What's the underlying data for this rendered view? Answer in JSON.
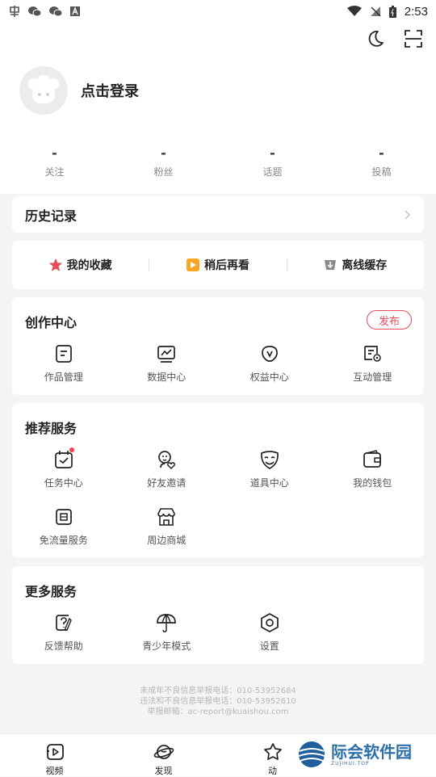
{
  "status_bar": {
    "time": "2:53",
    "left_icons": [
      "app-icon",
      "wechat-icon",
      "wechat-icon",
      "a-icon"
    ],
    "right_icons": [
      "wifi-icon",
      "no-signal-icon",
      "battery-icon"
    ]
  },
  "header": {
    "login_text": "点击登录"
  },
  "stats": [
    {
      "value": "-",
      "label": "关注"
    },
    {
      "value": "-",
      "label": "粉丝"
    },
    {
      "value": "-",
      "label": "话题"
    },
    {
      "value": "-",
      "label": "投稿"
    }
  ],
  "history": {
    "title": "历史记录"
  },
  "shortcuts": [
    {
      "label": "我的收藏",
      "icon": "star-icon",
      "color": "#e94b58"
    },
    {
      "label": "稍后再看",
      "icon": "play-icon",
      "color": "#f5a623"
    },
    {
      "label": "离线缓存",
      "icon": "download-icon",
      "color": "#8a8a8a"
    }
  ],
  "creator": {
    "title": "创作中心",
    "publish_label": "发布",
    "items": [
      {
        "label": "作品管理",
        "icon": "works-icon"
      },
      {
        "label": "数据中心",
        "icon": "chart-icon"
      },
      {
        "label": "权益中心",
        "icon": "rights-icon"
      },
      {
        "label": "互动管理",
        "icon": "interaction-icon"
      }
    ]
  },
  "recommended": {
    "title": "推荐服务",
    "items": [
      {
        "label": "任务中心",
        "icon": "calendar-icon",
        "badge": true
      },
      {
        "label": "好友邀请",
        "icon": "invite-icon"
      },
      {
        "label": "道具中心",
        "icon": "mask-icon"
      },
      {
        "label": "我的钱包",
        "icon": "wallet-icon"
      },
      {
        "label": "免流量服务",
        "icon": "sim-icon"
      },
      {
        "label": "周边商城",
        "icon": "shop-icon"
      }
    ]
  },
  "more": {
    "title": "更多服务",
    "items": [
      {
        "label": "反馈帮助",
        "icon": "feedback-icon"
      },
      {
        "label": "青少年模式",
        "icon": "umbrella-icon"
      },
      {
        "label": "设置",
        "icon": "settings-icon"
      }
    ]
  },
  "footer": {
    "line1": "未成年不良信息举报电话：010-53952684",
    "line2": "违法和不良信息举报电话：010-53952610",
    "line3": "举报邮箱：ac-report@kuaishou.com"
  },
  "tabs": [
    {
      "label": "视频",
      "icon": "video-tab-icon"
    },
    {
      "label": "发现",
      "icon": "discover-tab-icon"
    },
    {
      "label": "动",
      "icon": "dynamic-tab-icon"
    },
    {
      "label": "",
      "icon": ""
    }
  ],
  "watermark": {
    "text": "际会软件园",
    "sub": "ZUJIHUI.TOP"
  },
  "colors": {
    "accent": "#e94b58",
    "background": "#f4f4f4"
  }
}
